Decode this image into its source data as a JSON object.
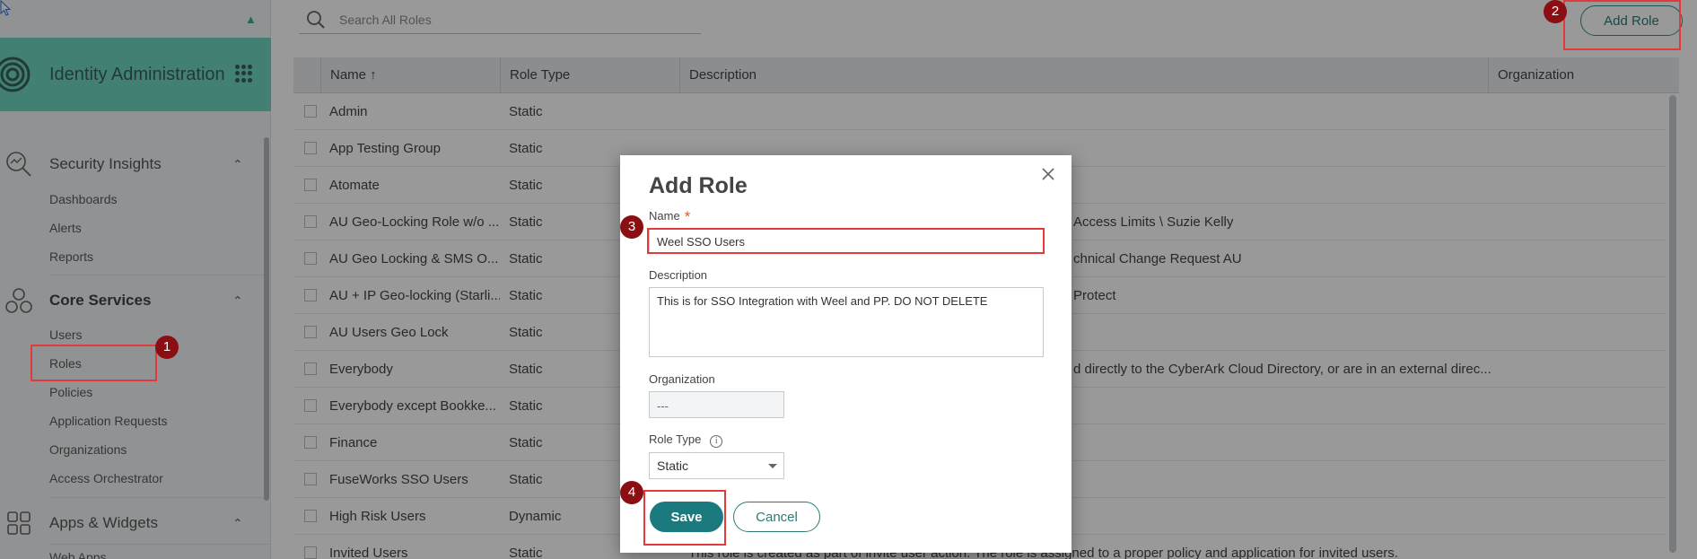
{
  "sidebar": {
    "app_title": "Identity Administration",
    "sections": [
      {
        "title": "Security Insights",
        "items": [
          "Dashboards",
          "Alerts",
          "Reports"
        ]
      },
      {
        "title": "Core Services",
        "items": [
          "Users",
          "Roles",
          "Policies",
          "Application Requests",
          "Organizations",
          "Access Orchestrator"
        ]
      },
      {
        "title": "Apps & Widgets",
        "items": [
          "Web Apps"
        ]
      }
    ]
  },
  "search": {
    "placeholder": "Search All Roles"
  },
  "toolbar": {
    "add_role_label": "Add Role"
  },
  "table": {
    "columns": [
      "Name ↑",
      "Role Type",
      "Description",
      "Organization"
    ],
    "rows": [
      {
        "name": "Admin",
        "type": "Static",
        "desc": ""
      },
      {
        "name": "App Testing Group",
        "type": "Static",
        "desc": ""
      },
      {
        "name": "Atomate",
        "type": "Static",
        "desc": ""
      },
      {
        "name": "AU Geo-Locking Role w/o ...",
        "type": "Static",
        "desc": "Access Limits \\ Suzie Kelly"
      },
      {
        "name": "AU Geo Locking & SMS O...",
        "type": "Static",
        "desc": "chnical Change Request AU"
      },
      {
        "name": "AU + IP Geo-locking (Starli...",
        "type": "Static",
        "desc": "Protect"
      },
      {
        "name": "AU Users Geo Lock",
        "type": "Static",
        "desc": ""
      },
      {
        "name": "Everybody",
        "type": "Static",
        "desc": "d directly to the CyberArk Cloud Directory, or are in an external direc..."
      },
      {
        "name": "Everybody except Bookke...",
        "type": "Static",
        "desc": ""
      },
      {
        "name": "Finance",
        "type": "Static",
        "desc": ""
      },
      {
        "name": "FuseWorks SSO Users",
        "type": "Static",
        "desc": ""
      },
      {
        "name": "High Risk Users",
        "type": "Dynamic",
        "desc": ""
      },
      {
        "name": "Invited Users",
        "type": "Static",
        "desc": "This role is created as part of invite user action. The role is assigned to a proper policy and application for invited users."
      }
    ]
  },
  "dialog": {
    "title": "Add Role",
    "name_label": "Name",
    "required_mark": "*",
    "name_value": "Weel SSO Users",
    "description_label": "Description",
    "description_value": "This is for SSO Integration with Weel and PP. DO NOT DELETE",
    "organization_label": "Organization",
    "organization_value": "---",
    "role_type_label": "Role Type",
    "info_glyph": "i",
    "role_type_value": "Static",
    "save_label": "Save",
    "cancel_label": "Cancel"
  },
  "annotations": [
    "1",
    "2",
    "3",
    "4"
  ],
  "colors": {
    "brand": "#6fd5c2",
    "accent": "#1a7a7e",
    "highlight": "#e03a3a",
    "badge": "#8b0f12"
  }
}
